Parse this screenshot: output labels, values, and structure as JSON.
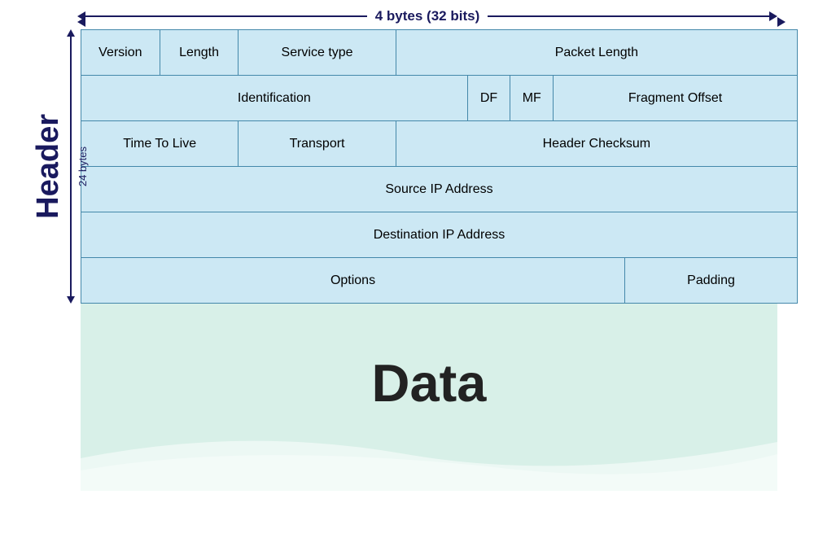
{
  "diagram": {
    "top_label": "4 bytes (32 bits)",
    "left_label": "Header",
    "bytes_label": "24 bytes",
    "rows": [
      {
        "cells": [
          {
            "label": "Version",
            "span": 1,
            "class": "cell-version"
          },
          {
            "label": "Length",
            "span": 1,
            "class": "cell-length"
          },
          {
            "label": "Service type",
            "span": 1,
            "class": "cell-service"
          },
          {
            "label": "Packet Length",
            "span": 1,
            "class": "cell-packet-length"
          }
        ]
      },
      {
        "cells": [
          {
            "label": "Identification",
            "span": 1,
            "class": "cell-identification"
          },
          {
            "label": "DF",
            "span": 1,
            "class": "cell-df"
          },
          {
            "label": "MF",
            "span": 1,
            "class": "cell-mf"
          },
          {
            "label": "Fragment Offset",
            "span": 1,
            "class": "cell-fragment"
          }
        ]
      },
      {
        "cells": [
          {
            "label": "Time To Live",
            "span": 1,
            "class": "cell-ttl"
          },
          {
            "label": "Transport",
            "span": 1,
            "class": "cell-transport"
          },
          {
            "label": "Header Checksum",
            "span": 1,
            "class": "cell-checksum"
          }
        ]
      },
      {
        "cells": [
          {
            "label": "Source IP Address",
            "span": 1,
            "class": "cell-full"
          }
        ]
      },
      {
        "cells": [
          {
            "label": "Destination IP Address",
            "span": 1,
            "class": "cell-full"
          }
        ]
      },
      {
        "cells": [
          {
            "label": "Options",
            "span": 1,
            "class": "cell-options"
          },
          {
            "label": "Padding",
            "span": 1,
            "class": "cell-padding"
          }
        ]
      }
    ],
    "data_label": "Data"
  }
}
